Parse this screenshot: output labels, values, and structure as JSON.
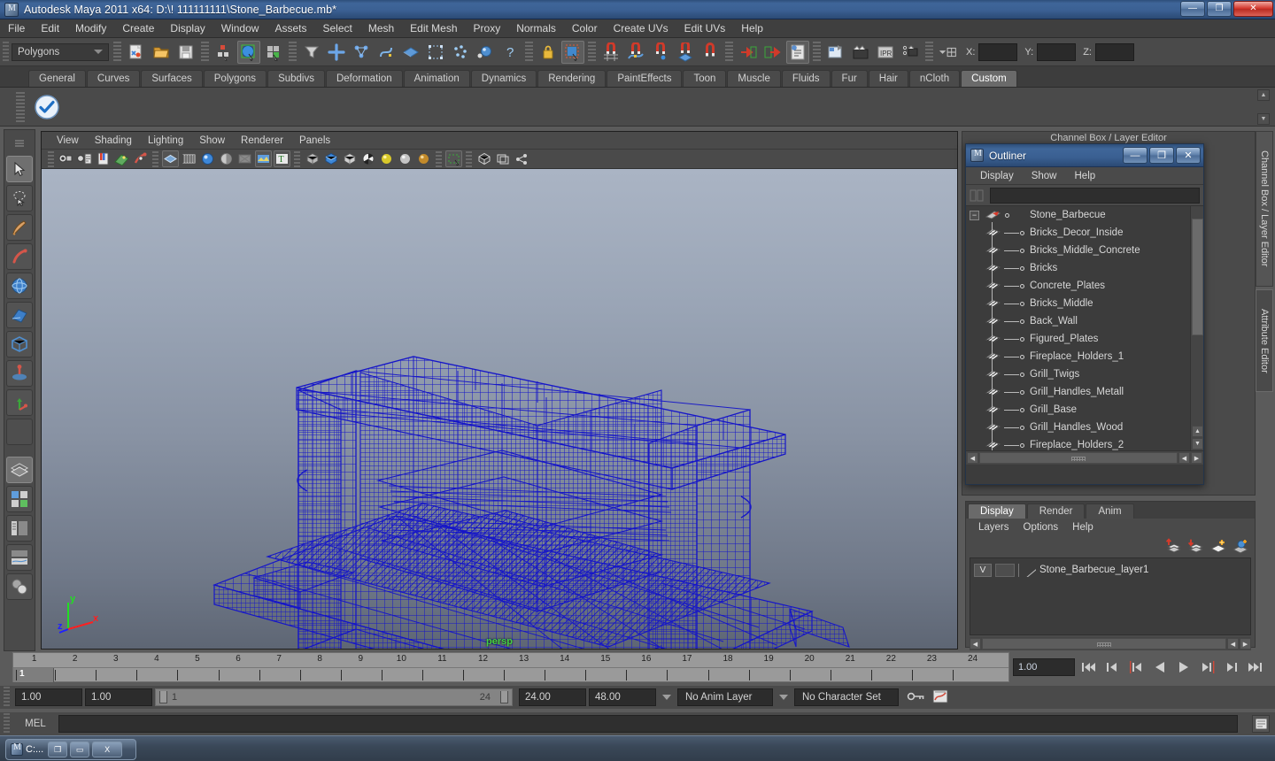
{
  "window": {
    "title": "Autodesk Maya 2011 x64: D:\\! 111111111\\Stone_Barbecue.mb*",
    "minimize": "—",
    "maximize": "❐",
    "close": "✕"
  },
  "menubar": {
    "items": [
      "File",
      "Edit",
      "Modify",
      "Create",
      "Display",
      "Window",
      "Assets",
      "Select",
      "Mesh",
      "Edit Mesh",
      "Proxy",
      "Normals",
      "Color",
      "Create UVs",
      "Edit UVs",
      "Help"
    ]
  },
  "statusline": {
    "mode": "Polygons",
    "x_label": "X:",
    "y_label": "Y:",
    "z_label": "Z:",
    "x_value": "",
    "y_value": "",
    "z_value": ""
  },
  "shelf": {
    "tabs": [
      "General",
      "Curves",
      "Surfaces",
      "Polygons",
      "Subdivs",
      "Deformation",
      "Animation",
      "Dynamics",
      "Rendering",
      "PaintEffects",
      "Toon",
      "Muscle",
      "Fluids",
      "Fur",
      "Hair",
      "nCloth",
      "Custom"
    ],
    "active_tab": "Custom"
  },
  "viewport": {
    "menus": [
      "View",
      "Shading",
      "Lighting",
      "Show",
      "Renderer",
      "Panels"
    ],
    "camera_label": "persp",
    "axis": {
      "x": "x",
      "y": "y",
      "z": "z"
    }
  },
  "channelbox_title": "Channel Box / Layer Editor",
  "outliner": {
    "title": "Outliner",
    "window_buttons": {
      "minimize": "—",
      "maximize": "❐",
      "close": "✕"
    },
    "menus": [
      "Display",
      "Show",
      "Help"
    ],
    "search_value": "",
    "root": {
      "label": "Stone_Barbecue",
      "expanded": true,
      "expand_glyph": "−"
    },
    "children": [
      "Bricks_Decor_Inside",
      "Bricks_Middle_Concrete",
      "Bricks",
      "Concrete_Plates",
      "Bricks_Middle",
      "Back_Wall",
      "Figured_Plates",
      "Fireplace_Holders_1",
      "Grill_Twigs",
      "Grill_Handles_Metall",
      "Grill_Base",
      "Grill_Handles_Wood",
      "Fireplace_Holders_2"
    ]
  },
  "layer_editor": {
    "tabs": [
      "Display",
      "Render",
      "Anim"
    ],
    "active_tab": "Display",
    "menus": [
      "Layers",
      "Options",
      "Help"
    ],
    "layers": [
      {
        "visibility": "V",
        "type": "",
        "name": "Stone_Barbecue_layer1"
      }
    ]
  },
  "side_tabs": [
    {
      "label": "Channel Box / Layer Editor",
      "active": false
    },
    {
      "label": "Attribute Editor",
      "active": true
    }
  ],
  "timeline": {
    "ticks": [
      "1",
      "2",
      "3",
      "4",
      "5",
      "6",
      "7",
      "8",
      "9",
      "10",
      "11",
      "12",
      "13",
      "14",
      "15",
      "16",
      "17",
      "18",
      "19",
      "20",
      "21",
      "22",
      "23",
      "24"
    ],
    "current_frame": "1",
    "current_frame_field": "1.00",
    "playback": [
      "go-to-start",
      "step-back-key",
      "step-back-frame",
      "play-backwards",
      "play-forwards",
      "step-forward-frame",
      "step-forward-key",
      "go-to-end"
    ]
  },
  "range": {
    "start": "1.00",
    "end": "1.00",
    "slider_min": "1",
    "slider_max": "24",
    "anim_start": "24.00",
    "anim_end": "48.00",
    "anim_layer": "No Anim Layer",
    "character_set": "No Character Set"
  },
  "command_line": {
    "label": "MEL",
    "value": ""
  },
  "taskbar": {
    "item_label": "C:...",
    "restore": "❐",
    "maximize": "▭",
    "close": "X"
  },
  "colors": {
    "wireframe": "#1616c8",
    "accent_blue": "#3f6699",
    "axis_x": "#ff2020",
    "axis_y": "#22dd22",
    "axis_z": "#2020ff",
    "persp_green": "#43d043"
  }
}
